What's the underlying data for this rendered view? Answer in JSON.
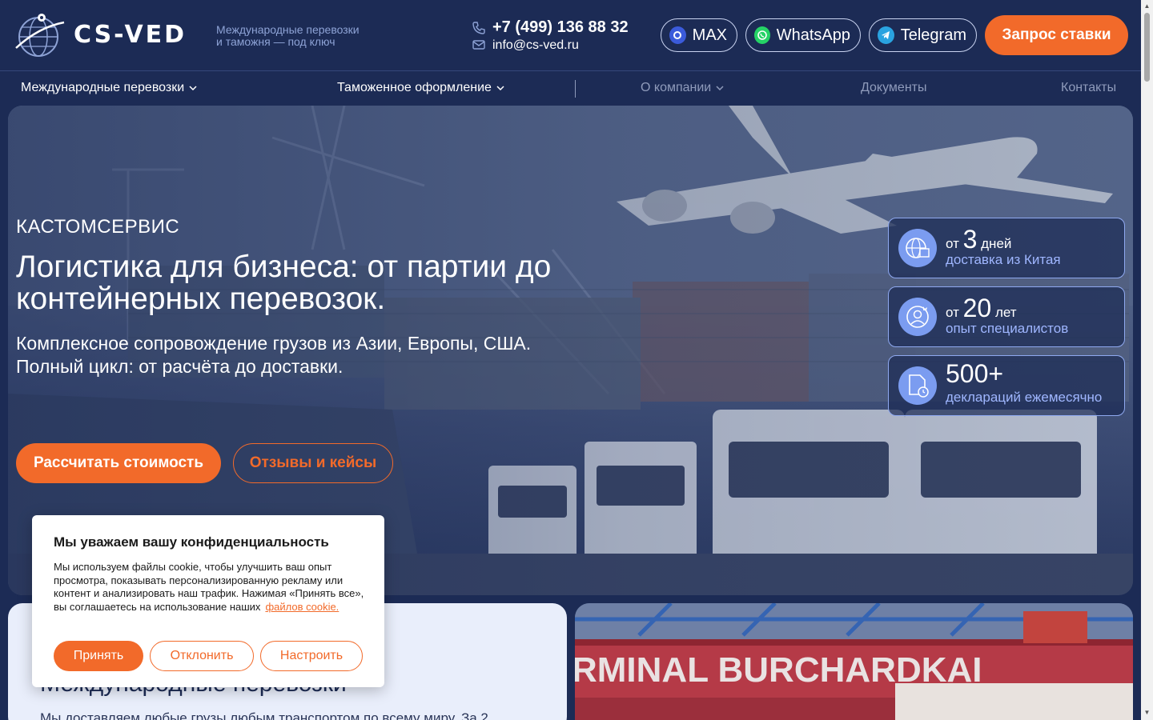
{
  "header": {
    "logo_text": "CS-VED",
    "tagline_line1": "Международные перевозки",
    "tagline_line2": "и таможня — под ключ",
    "phone": "+7 (499) 136 88 32",
    "email": "info@cs-ved.ru",
    "messengers": [
      {
        "label": "MAX",
        "icon": "max-icon",
        "color": "#3b5bdb"
      },
      {
        "label": "WhatsApp",
        "icon": "whatsapp-icon",
        "color": "#25d366"
      },
      {
        "label": "Telegram",
        "icon": "telegram-icon",
        "color": "#2aa3e0"
      }
    ],
    "request_button": "Запрос ставки"
  },
  "nav": {
    "items": [
      {
        "label": "Международные перевозки",
        "has_dropdown": true
      },
      {
        "label": "Таможенное оформление",
        "has_dropdown": true
      },
      {
        "label": "О компании",
        "has_dropdown": true
      },
      {
        "label": "Документы",
        "has_dropdown": false
      },
      {
        "label": "Контакты",
        "has_dropdown": false
      }
    ]
  },
  "hero": {
    "brand": "КАСТОМСЕРВИС",
    "title": "Логистика для бизнеса: от партии до контейнерных перевозок.",
    "subtitle_line1": "Комплексное сопровождение грузов из Азии, Европы, США.",
    "subtitle_line2": "Полный цикл: от расчёта до доставки.",
    "calc_button": "Рассчитать стоимость",
    "reviews_button": "Отзывы и кейсы",
    "stats": [
      {
        "prefix": "от",
        "value": "3",
        "suffix": "дней",
        "caption": "доставка из Китая",
        "icon": "globe-box-icon"
      },
      {
        "prefix": "от",
        "value": "20",
        "suffix": "лет",
        "caption": "опыт специалистов",
        "icon": "expert-icon"
      },
      {
        "prefix": "",
        "value": "500+",
        "suffix": "",
        "caption": "деклараций ежемесячно",
        "icon": "document-clock-icon"
      }
    ]
  },
  "section": {
    "title": "Международные перевозки",
    "text": "Мы доставляем любые грузы любым транспортом по всему миру. За 2",
    "terminal_sign": "RMINAL BURCHARDKAI"
  },
  "cookie": {
    "title": "Мы уважаем вашу конфиденциальность",
    "text": "Мы используем файлы cookie, чтобы улучшить ваш опыт просмотра, показывать персонализированную рекламу или контент и анализировать наш трафик. Нажимая «Принять все», вы соглашаетесь на использование наших",
    "link": "файлов cookie.",
    "accept": "Принять",
    "decline": "Отклонить",
    "settings": "Настроить"
  },
  "colors": {
    "background": "#1c2b55",
    "accent": "#f26a2a",
    "stat_border": "#8fa9f0"
  }
}
